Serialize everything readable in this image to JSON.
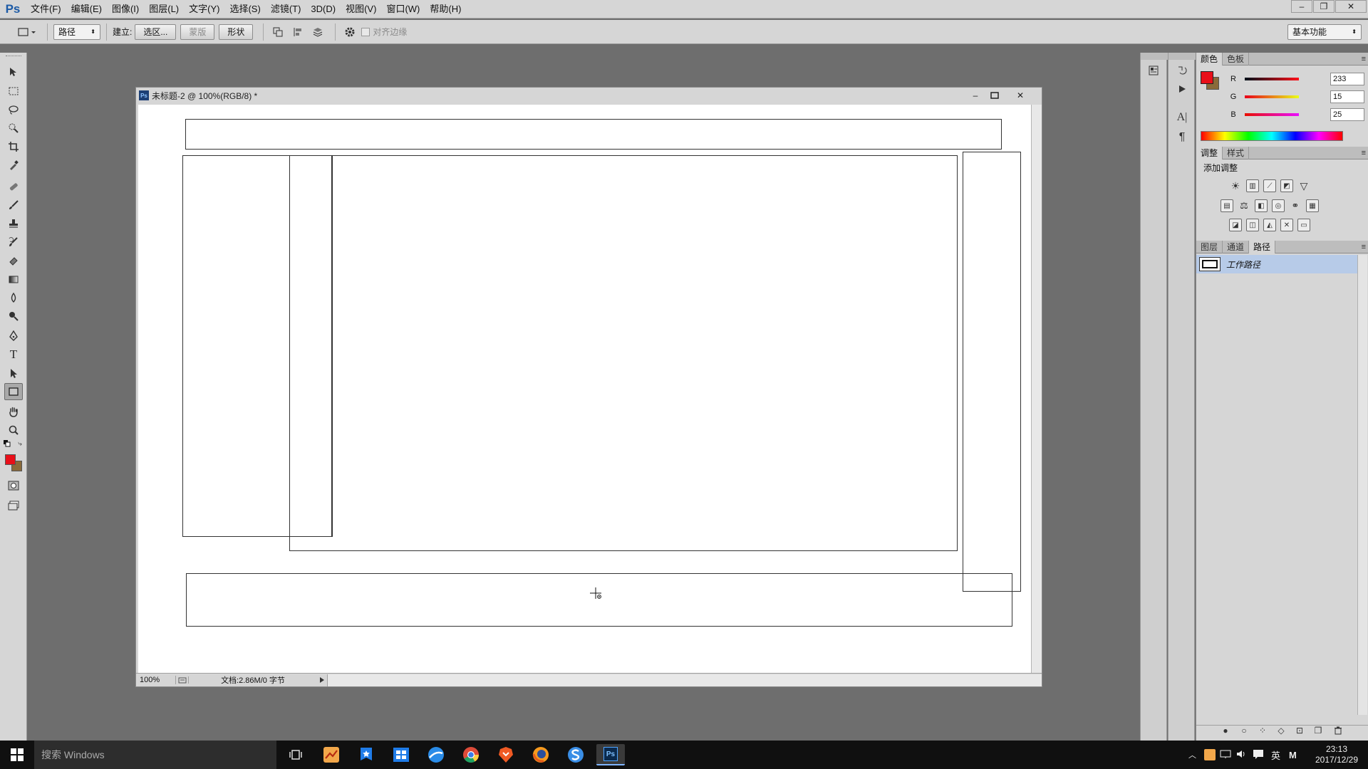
{
  "app": {
    "logo": "Ps"
  },
  "menubar": {
    "items": [
      "文件(F)",
      "编辑(E)",
      "图像(I)",
      "图层(L)",
      "文字(Y)",
      "选择(S)",
      "滤镜(T)",
      "3D(D)",
      "视图(V)",
      "窗口(W)",
      "帮助(H)"
    ]
  },
  "window_controls": {
    "minimize": "–",
    "restore": "❐",
    "close": "✕"
  },
  "options": {
    "mode_select": "路径",
    "create_label": "建立:",
    "selection_btn": "选区...",
    "mask_btn": "蒙版",
    "shape_btn": "形状",
    "align_edges_label": "对齐边缘",
    "workspace_select": "基本功能"
  },
  "document": {
    "title": "未标题-2 @ 100%(RGB/8) *",
    "zoom": "100%",
    "doc_info": "文档:2.86M/0 字节"
  },
  "panels": {
    "color": {
      "tabs": [
        "颜色",
        "色板"
      ],
      "r_label": "R",
      "g_label": "G",
      "b_label": "B",
      "r": "233",
      "g": "15",
      "b": "25",
      "foreground": "#e90f19",
      "background": "#8a6a3a"
    },
    "adjust": {
      "tabs": [
        "调整",
        "样式"
      ],
      "heading": "添加调整"
    },
    "layers": {
      "tabs": [
        "图层",
        "通道",
        "路径"
      ],
      "active_tab": "路径",
      "paths": [
        {
          "name": "工作路径"
        }
      ]
    }
  },
  "taskbar": {
    "search_placeholder": "搜索 Windows",
    "ime_lang": "英",
    "ime_mode": "M",
    "time": "23:13",
    "date": "2017/12/29"
  }
}
